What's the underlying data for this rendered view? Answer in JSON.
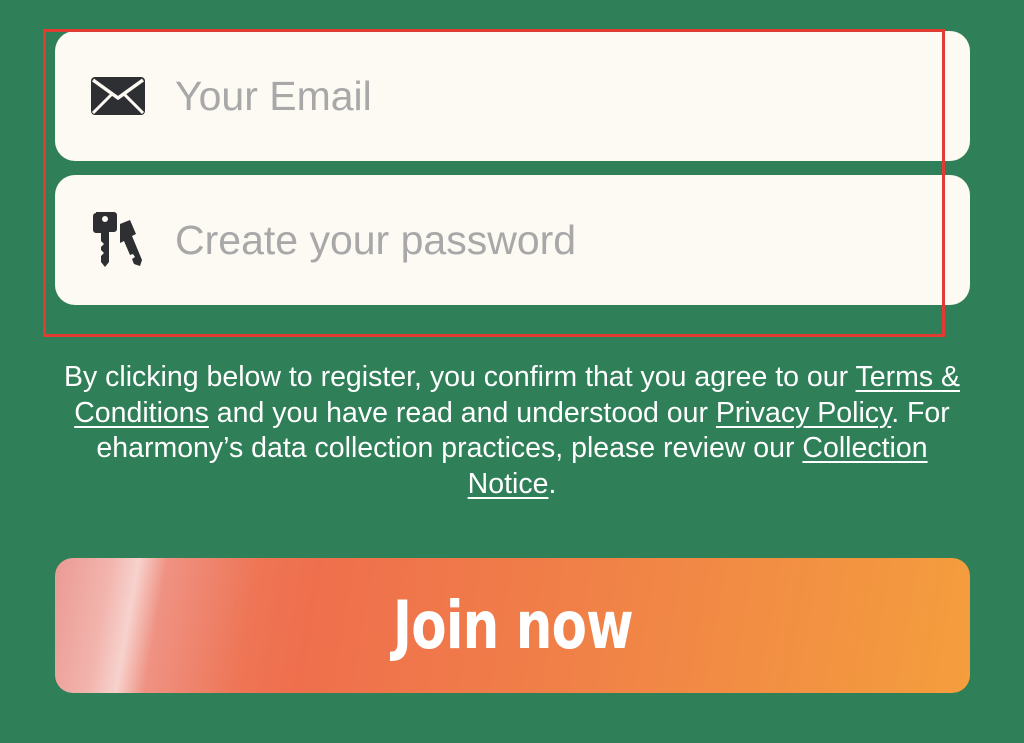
{
  "form": {
    "email": {
      "icon": "envelope-icon",
      "placeholder": "Your Email",
      "value": ""
    },
    "password": {
      "icon": "keys-icon",
      "placeholder": "Create your password",
      "value": ""
    }
  },
  "legal": {
    "intro": "By clicking below to register, you confirm that you agree to our ",
    "terms_link": "Terms & Conditions",
    "middle": " and you have read and understood our ",
    "privacy_link": "Privacy Policy",
    "after_privacy": ". For eharmony’s data collection practices, please review our ",
    "collection_link": "Collection Notice",
    "end": "."
  },
  "join_button": {
    "label": "Join now"
  },
  "colors": {
    "background": "#2f7f58",
    "field_background": "#fdf9f3",
    "highlight": "#e23b32",
    "button_start": "#ea9a92",
    "button_end": "#f49e3d"
  }
}
